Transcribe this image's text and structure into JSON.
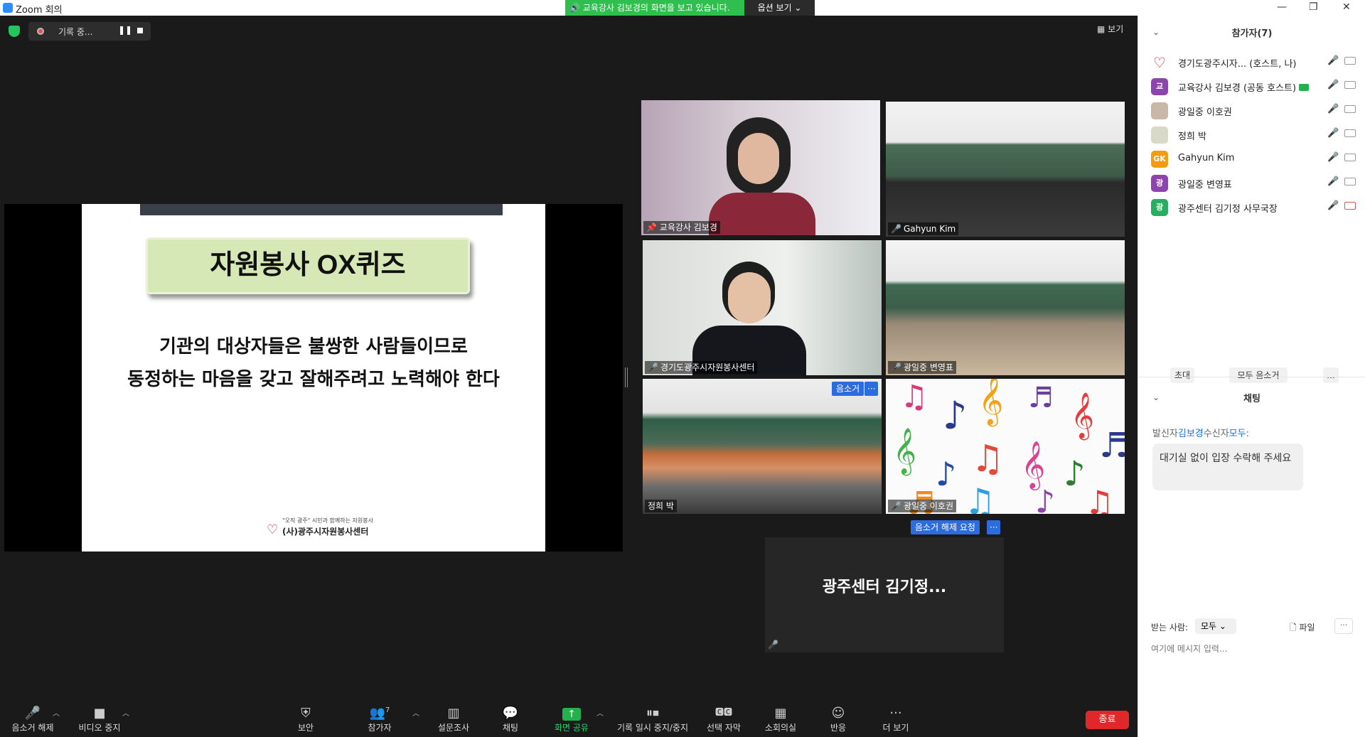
{
  "window": {
    "title": "Zoom 회의",
    "controls": [
      "—",
      "❐",
      "✕"
    ]
  },
  "share_banner": {
    "text": "교육강사 김보경의 화면을 보고 있습니다.",
    "options_label": "옵션 보기 ⌄"
  },
  "recording": {
    "label": "기록 중..."
  },
  "view_button": {
    "label": "보기"
  },
  "slide": {
    "title": "자원봉사 OX퀴즈",
    "line1": "기관의 대상자들은 불쌍한 사람들이므로",
    "line2": "동정하는 마음을 갖고 잘해주려고 노력해야 한다",
    "logo_small": "\"오직 광주\" 시민과 함께하는 자원봉사",
    "logo_big": "(사)광주시자원봉사센터"
  },
  "video_tiles": [
    {
      "name": "교육강사 김보경",
      "pinned": true,
      "active_speaker": true
    },
    {
      "name": "Gahyun Kim",
      "muted": true
    },
    {
      "name": "경기도광주시자원봉사센터",
      "muted": true
    },
    {
      "name": "광일중 변영표",
      "muted": true
    },
    {
      "name": "정희 박",
      "button": "음소거",
      "more": "···"
    },
    {
      "name": "광일중 이호권",
      "muted": true
    }
  ],
  "unmute_request": {
    "button": "음소거 해제 요청",
    "more": "···"
  },
  "name_only_tile": {
    "name": "광주센터 김기정..."
  },
  "toolbar": {
    "mute": "음소거 해제",
    "video": "비디오 중지",
    "security": "보안",
    "participants": "참가자",
    "participant_count": "7",
    "poll": "설문조사",
    "chat": "채팅",
    "share": "화면 공유",
    "record": "기록 일시 중지/중지",
    "captions": "선택 자막",
    "breakout": "소회의실",
    "reactions": "반응",
    "more": "더 보기",
    "end": "종료"
  },
  "participants_panel": {
    "header": "참가자(7)",
    "items": [
      {
        "name": "경기도광주시자...  (호스트, 나)",
        "avatar": "♡",
        "avatar_color": "#ffffff",
        "mic": "off",
        "cam": "on"
      },
      {
        "name": "교육강사 김보경 (공동 호스트)",
        "avatar": "교",
        "avatar_color": "#8e44ad",
        "mic": "on",
        "cam": "on",
        "sharing": true
      },
      {
        "name": "광일중 이호권",
        "avatar": "",
        "avatar_color": "#c9b8a6",
        "mic": "on",
        "cam": "on"
      },
      {
        "name": "정희 박",
        "avatar": "",
        "avatar_color": "#d9d9c8",
        "mic": "on",
        "cam": "on"
      },
      {
        "name": "Gahyun Kim",
        "avatar": "GK",
        "avatar_color": "#f39c12",
        "mic": "off",
        "cam": "on"
      },
      {
        "name": "광일중 변영표",
        "avatar": "광",
        "avatar_color": "#8e44ad",
        "mic": "off",
        "cam": "on"
      },
      {
        "name": "광주센터 김기정 사무국장",
        "avatar": "광",
        "avatar_color": "#27ae60",
        "mic": "off",
        "cam": "off"
      }
    ],
    "invite": "초대",
    "mute_all": "모두 음소거",
    "more": "..."
  },
  "chat_panel": {
    "header": "채팅",
    "from_label": "발신자",
    "from": "김보경",
    "to_label": "수신자",
    "to": "모두",
    "message": "대기실 없이 입장 수락해 주세요",
    "recipient_label": "받는 사람:",
    "recipient_value": "모두 ⌄",
    "file_label": "파일",
    "input_placeholder": "여기에 메시지 입력..."
  }
}
